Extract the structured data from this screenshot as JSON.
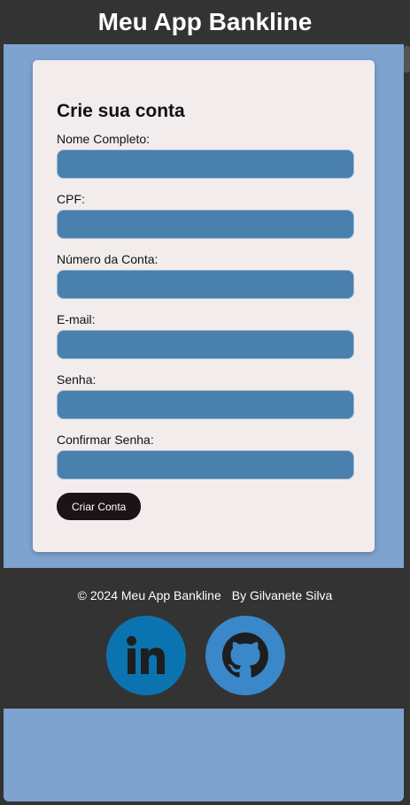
{
  "header": {
    "title": "Meu App Bankline"
  },
  "form": {
    "heading": "Crie sua conta",
    "fields": [
      {
        "label": "Nome Completo:",
        "value": ""
      },
      {
        "label": "CPF:",
        "value": ""
      },
      {
        "label": "Número da Conta:",
        "value": ""
      },
      {
        "label": "E-mail:",
        "value": ""
      },
      {
        "label": "Senha:",
        "value": ""
      },
      {
        "label": "Confirmar Senha:",
        "value": ""
      }
    ],
    "submit_label": "Criar Conta"
  },
  "footer": {
    "copyright": "© 2024 Meu App Bankline",
    "author": "By Gilvanete Silva",
    "social": [
      {
        "icon": "linkedin-icon",
        "color": "#0b74b0"
      },
      {
        "icon": "github-icon",
        "color": "#3a87c9"
      }
    ]
  },
  "colors": {
    "page_background": "#7ea3cf",
    "header_background": "#333333",
    "card_background": "#f3eced",
    "input_background": "#4a80ad",
    "button_background": "#1b1318"
  }
}
